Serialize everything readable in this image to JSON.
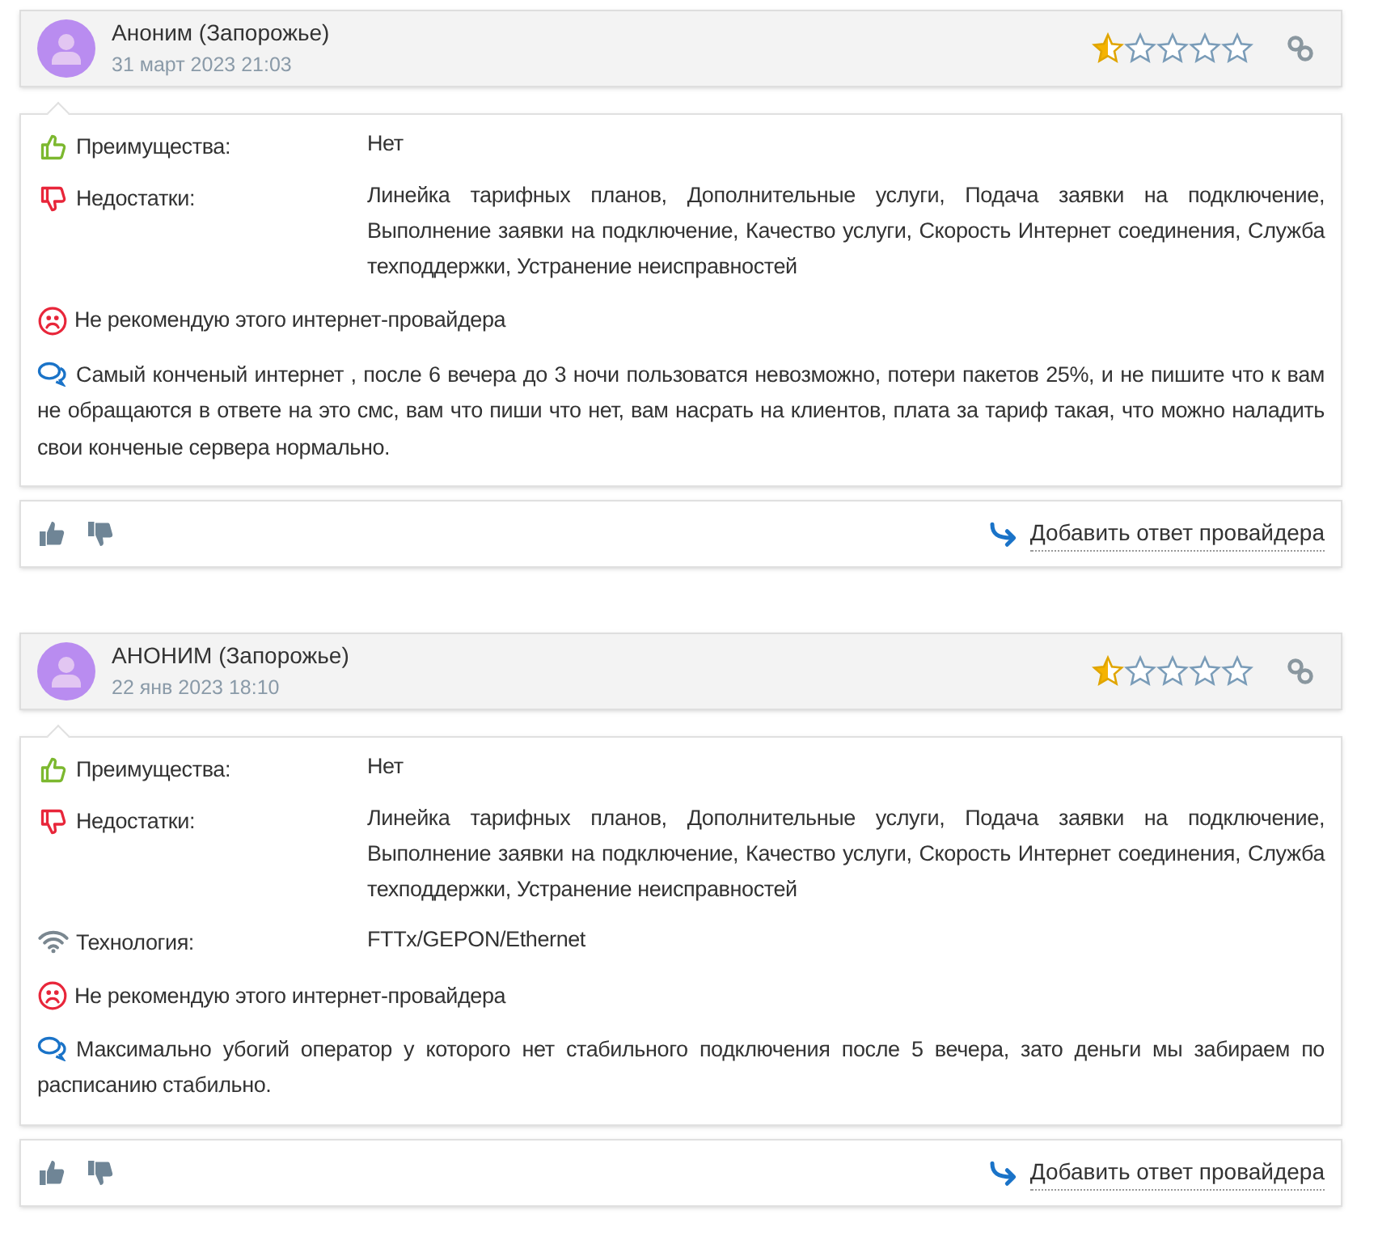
{
  "reviews": [
    {
      "author": "Аноним (Запорожье)",
      "date": "31 март 2023 21:03",
      "stars": 0.5,
      "fields": [
        {
          "kind": "pros",
          "label": "Преимущества:",
          "value": "Нет"
        },
        {
          "kind": "cons",
          "label": "Недостатки:",
          "value": "Линейка тарифных планов, Дополнительные услуги, Подача заявки на подключение, Выполнение заявки на подключение, Качество услуги, Скорость Интернет соединения, Служба техподдержки, Устранение неисправностей"
        }
      ],
      "recommend": {
        "recommended": false,
        "text": "Не рекомендую этого интернет-провайдера"
      },
      "comment": "Самый конченый интернет , после 6 вечера до 3 ночи пользоватся невозможно, потери пакетов 25%, и не пишите что к вам не обращаются в ответе на это смс, вам что пиши что нет, вам насрать на клиентов, плата за тариф такая, что можно наладить свои конченые сервера нормально.",
      "reply_link": "Добавить ответ провайдера"
    },
    {
      "author": "АНОНИМ (Запорожье)",
      "date": "22 янв 2023 18:10",
      "stars": 0.5,
      "fields": [
        {
          "kind": "pros",
          "label": "Преимущества:",
          "value": "Нет"
        },
        {
          "kind": "cons",
          "label": "Недостатки:",
          "value": "Линейка тарифных планов, Дополнительные услуги, Подача заявки на подключение, Выполнение заявки на подключение, Качество услуги, Скорость Интернет соединения, Служба техподдержки, Устранение неисправностей"
        },
        {
          "kind": "tech",
          "label": "Технология:",
          "value": "FTTx/GEPON/Ethernet"
        }
      ],
      "recommend": {
        "recommended": false,
        "text": "Не рекомендую этого интернет-провайдера"
      },
      "comment": "Максимально убогий оператор у которого нет стабильного подключения после 5 вечера, зато деньги мы забираем по расписанию стабильно.",
      "reply_link": "Добавить ответ провайдера"
    }
  ]
}
